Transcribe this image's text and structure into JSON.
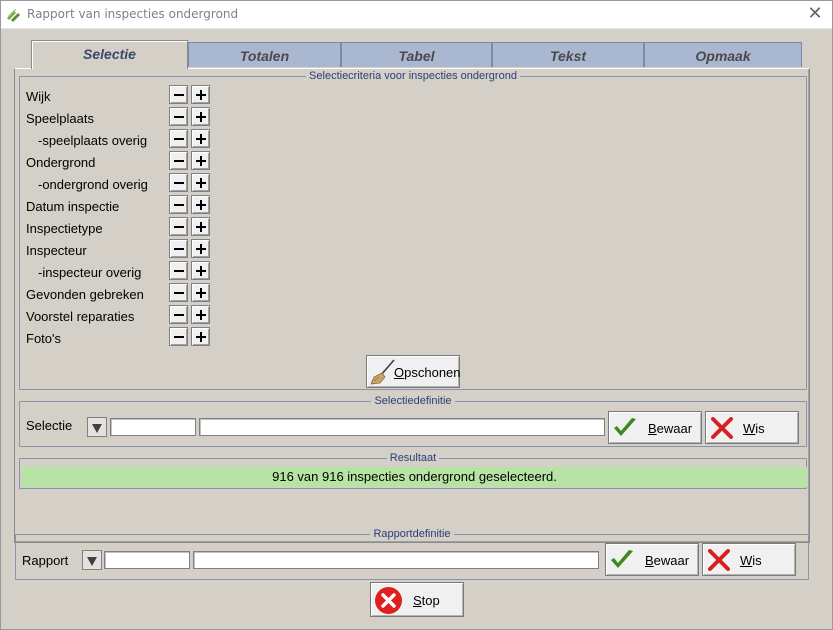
{
  "window": {
    "title": "Rapport van inspecties ondergrond",
    "app_icon": "app-icon",
    "close_glyph": "✕"
  },
  "tabs": [
    {
      "label": "Selectie",
      "active": true
    },
    {
      "label": "Totalen",
      "active": false
    },
    {
      "label": "Tabel",
      "active": false
    },
    {
      "label": "Tekst",
      "active": false
    },
    {
      "label": "Opmaak",
      "active": false
    }
  ],
  "criteria": {
    "title": "Selectiecriteria voor inspecties ondergrond",
    "items": [
      {
        "label": "Wijk"
      },
      {
        "label": "Speelplaats"
      },
      {
        "label": "-speelplaats overig"
      },
      {
        "label": "Ondergrond"
      },
      {
        "label": "-ondergrond overig"
      },
      {
        "label": "Datum inspectie"
      },
      {
        "label": "Inspectietype"
      },
      {
        "label": "Inspecteur"
      },
      {
        "label": "-inspecteur overig"
      },
      {
        "label": "Gevonden gebreken"
      },
      {
        "label": "Voorstel reparaties"
      },
      {
        "label": "Foto's"
      }
    ],
    "clear_button": {
      "label_first": "O",
      "label_rest": "pschonen",
      "icon": "broom-icon"
    }
  },
  "selectiedefinitie": {
    "title": "Selectiedefinitie",
    "label": "Selectie",
    "code_value": "",
    "name_value": "",
    "save_button": {
      "label_first": "B",
      "label_rest": "ewaar",
      "icon": "checkmark-icon"
    },
    "clear_button": {
      "label_first": "W",
      "label_rest": "is",
      "icon": "cross-icon"
    }
  },
  "resultaat": {
    "title": "Resultaat",
    "text": "916 van 916 inspecties ondergrond geselecteerd.",
    "color": "#b7e4a4"
  },
  "rapportdefinitie": {
    "title": "Rapportdefinitie",
    "label": "Rapport",
    "code_value": "",
    "name_value": "",
    "save_button": {
      "label_first": "B",
      "label_rest": "ewaar",
      "icon": "checkmark-icon"
    },
    "clear_button": {
      "label_first": "W",
      "label_rest": "is",
      "icon": "cross-icon"
    }
  },
  "stop_button": {
    "label_first": "S",
    "label_rest": "top",
    "icon": "stop-icon"
  },
  "colors": {
    "accent_tab": "#a9b7d1",
    "group_title": "#2a3e78",
    "check_green": "#3a8a1e",
    "cross_red": "#d42222"
  }
}
